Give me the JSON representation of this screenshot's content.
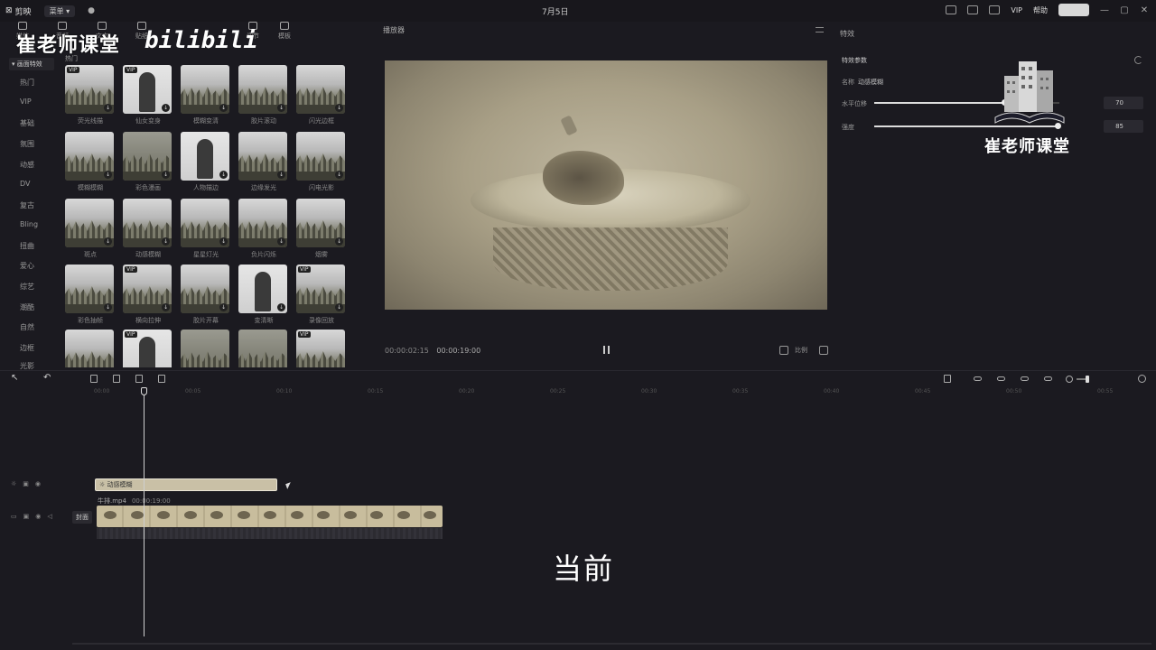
{
  "titlebar": {
    "app_name": "剪映",
    "menu_label": "菜单",
    "project_title": "7月5日",
    "vip_label": "VIP",
    "account_label": "帮助",
    "window_controls": [
      "—",
      "▢",
      "✕"
    ]
  },
  "watermark": {
    "left_text": "崔老师课堂",
    "bili_text": "bilibili",
    "right_text": "崔老师课堂"
  },
  "tool_tabs": [
    {
      "label": "媒体",
      "icon": "media-icon"
    },
    {
      "label": "音频",
      "icon": "audio-icon"
    },
    {
      "label": "文本",
      "icon": "text-icon"
    },
    {
      "label": "贴纸",
      "icon": "sticker-icon"
    },
    {
      "label": "调节",
      "icon": "adjust-icon"
    },
    {
      "label": "模板",
      "icon": "template-icon"
    }
  ],
  "sidebar": {
    "selected": "画面特效",
    "categories": [
      "热门",
      "VIP",
      "基础",
      "氛围",
      "动感",
      "DV",
      "复古",
      "Bling",
      "扭曲",
      "爱心",
      "综艺",
      "潮酷",
      "自然",
      "边框",
      "光影"
    ]
  },
  "grid_header": "热门",
  "effects": [
    {
      "label": "荧光线描",
      "vip": true,
      "type": "nature"
    },
    {
      "label": "仙女变身",
      "vip": true,
      "type": "person"
    },
    {
      "label": "模糊变清",
      "vip": false,
      "type": "nature"
    },
    {
      "label": "胶片滚动",
      "vip": false,
      "type": "nature"
    },
    {
      "label": "闪光边框",
      "vip": false,
      "type": "nature"
    },
    {
      "label": "模糊模糊",
      "vip": false,
      "type": "nature"
    },
    {
      "label": "彩色漫画",
      "vip": false,
      "type": "dark"
    },
    {
      "label": "人物描边",
      "vip": false,
      "type": "person"
    },
    {
      "label": "边缘发光",
      "vip": false,
      "type": "nature"
    },
    {
      "label": "闪电光影",
      "vip": false,
      "type": "nature"
    },
    {
      "label": "斑点",
      "vip": false,
      "type": "nature"
    },
    {
      "label": "动感模糊",
      "vip": false,
      "type": "nature"
    },
    {
      "label": "星星灯光",
      "vip": false,
      "type": "nature"
    },
    {
      "label": "负片闪烁",
      "vip": false,
      "type": "nature"
    },
    {
      "label": "烟雾",
      "vip": false,
      "type": "nature"
    },
    {
      "label": "彩色抽帧",
      "vip": false,
      "type": "nature"
    },
    {
      "label": "横向拉伸",
      "vip": true,
      "type": "nature"
    },
    {
      "label": "胶片开幕",
      "vip": false,
      "type": "nature"
    },
    {
      "label": "变清晰",
      "vip": false,
      "type": "person"
    },
    {
      "label": "录像回放",
      "vip": true,
      "type": "nature"
    },
    {
      "label": "",
      "vip": false,
      "type": "nature"
    },
    {
      "label": "",
      "vip": true,
      "type": "person"
    },
    {
      "label": "",
      "vip": false,
      "type": "dark"
    },
    {
      "label": "",
      "vip": false,
      "type": "dark"
    },
    {
      "label": "",
      "vip": true,
      "type": "nature"
    }
  ],
  "player": {
    "title": "播放器",
    "current_time": "00:00:02:15",
    "total_time": "00:00:19:00",
    "ratio_label": "比例"
  },
  "effect_panel": {
    "title": "特效",
    "subtitle": "特效参数",
    "name_label": "名称",
    "name_value": "动感模糊",
    "params": [
      {
        "label": "水平位移",
        "value": "70",
        "fraction": 0.7
      },
      {
        "label": "强度",
        "value": "85",
        "fraction": 0.99
      }
    ]
  },
  "timeline": {
    "ruler_ticks": [
      "00:00",
      "00:05",
      "00:10",
      "00:15",
      "00:20",
      "00:25",
      "00:30",
      "00:35",
      "00:40",
      "00:45",
      "00:50",
      "00:55"
    ],
    "effect_clip_label": "动感模糊",
    "video_clip_name": "牛排.mp4",
    "video_clip_duration": "00:00:19:00",
    "cover_label": "封面"
  },
  "caption": "当前"
}
